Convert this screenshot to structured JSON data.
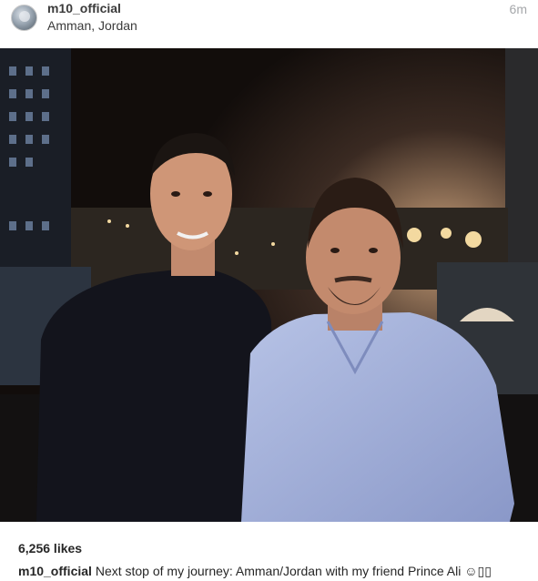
{
  "post": {
    "username": "m10_official",
    "location": "Amman, Jordan",
    "timestamp": "6m",
    "likes": "6,256 likes",
    "caption_user": "m10_official",
    "caption_text": " Next stop of my journey: Amman/Jordan with my friend Prince Ali ☺▯▯"
  },
  "icons": {
    "avatar": "profile-picture"
  },
  "colors": {
    "username": "#3b3b3b",
    "timestamp": "#a5a7aa",
    "text": "#262626",
    "photo_background": "#0d0b0a"
  }
}
